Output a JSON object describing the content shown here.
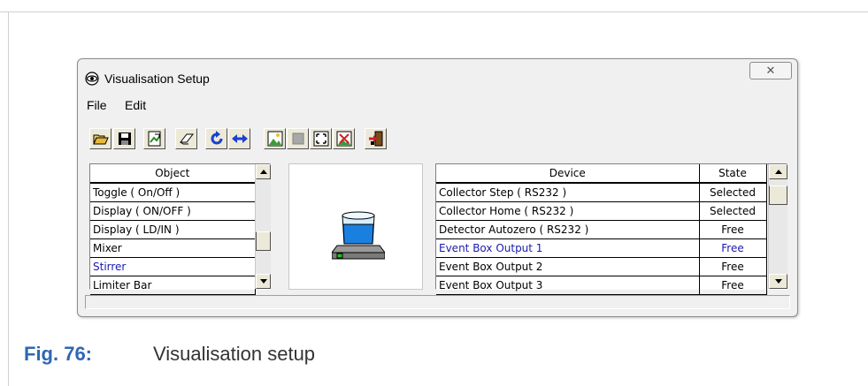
{
  "window": {
    "title": "Visualisation Setup",
    "close_glyph": "✕"
  },
  "menu": {
    "items": [
      "File",
      "Edit"
    ]
  },
  "toolbar": {
    "buttons": [
      "open-icon",
      "save-icon",
      "export-icon",
      "eraser-icon",
      "refresh-icon",
      "swap-icon",
      "image-icon",
      "stop-icon",
      "fit-icon",
      "delete-image-icon",
      "exit-icon"
    ]
  },
  "object_list": {
    "header": "Object",
    "rows": [
      {
        "label": "Toggle ( On/Off )",
        "selected": false
      },
      {
        "label": "Display ( ON/OFF )",
        "selected": false
      },
      {
        "label": "Display ( LD/IN )",
        "selected": false
      },
      {
        "label": "Mixer",
        "selected": false
      },
      {
        "label": "Stirrer",
        "selected": true
      },
      {
        "label": "Limiter Bar",
        "selected": false
      }
    ]
  },
  "preview": {
    "icon": "stirrer-icon"
  },
  "device_list": {
    "headers": {
      "device": "Device",
      "state": "State"
    },
    "rows": [
      {
        "device": "Collector Step ( RS232 )",
        "state": "Selected",
        "selected": false
      },
      {
        "device": "Collector Home ( RS232 )",
        "state": "Selected",
        "selected": false
      },
      {
        "device": "Detector Autozero ( RS232 )",
        "state": "Free",
        "selected": false
      },
      {
        "device": "Event Box Output 1",
        "state": "Free",
        "selected": true
      },
      {
        "device": "Event Box Output 2",
        "state": "Free",
        "selected": false
      },
      {
        "device": "Event Box Output 3",
        "state": "Free",
        "selected": false
      }
    ]
  },
  "caption": {
    "number": "Fig. 76:",
    "text": "Visualisation setup"
  },
  "colors": {
    "selected_text": "#1a1ab0",
    "caption_accent": "#2f67b3"
  }
}
